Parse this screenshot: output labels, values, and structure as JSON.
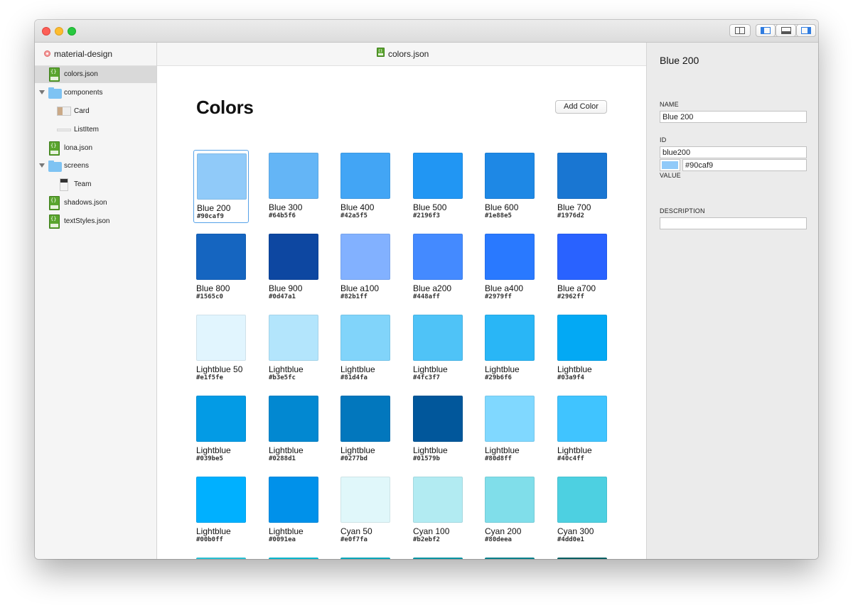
{
  "window": {
    "project_name": "material-design",
    "file_title": "colors.json"
  },
  "sidebar": {
    "items": [
      {
        "label": "colors.json",
        "icon": "json-file-icon",
        "selected": true
      },
      {
        "label": "components",
        "icon": "folder-icon"
      },
      {
        "label": "Card",
        "icon": "component-thumbnail-icon"
      },
      {
        "label": "ListItem",
        "icon": "component-thumbnail-icon"
      },
      {
        "label": "lona.json",
        "icon": "json-file-icon"
      },
      {
        "label": "screens",
        "icon": "folder-icon"
      },
      {
        "label": "Team",
        "icon": "screen-thumbnail-icon"
      },
      {
        "label": "shadows.json",
        "icon": "json-file-icon"
      },
      {
        "label": "textStyles.json",
        "icon": "json-file-icon"
      }
    ]
  },
  "main": {
    "title": "Colors",
    "add_button": "Add Color",
    "colors": [
      {
        "name": "Blue 200",
        "hex": "#90caf9",
        "selected": true
      },
      {
        "name": "Blue 300",
        "hex": "#64b5f6"
      },
      {
        "name": "Blue 400",
        "hex": "#42a5f5"
      },
      {
        "name": "Blue 500",
        "hex": "#2196f3"
      },
      {
        "name": "Blue 600",
        "hex": "#1e88e5"
      },
      {
        "name": "Blue 700",
        "hex": "#1976d2"
      },
      {
        "name": "Blue 800",
        "hex": "#1565c0"
      },
      {
        "name": "Blue 900",
        "hex": "#0d47a1"
      },
      {
        "name": "Blue a100",
        "hex": "#82b1ff"
      },
      {
        "name": "Blue a200",
        "hex": "#448aff"
      },
      {
        "name": "Blue a400",
        "hex": "#2979ff"
      },
      {
        "name": "Blue a700",
        "hex": "#2962ff"
      },
      {
        "name": "Lightblue 50",
        "hex": "#e1f5fe"
      },
      {
        "name": "Lightblue",
        "hex": "#b3e5fc"
      },
      {
        "name": "Lightblue",
        "hex": "#81d4fa"
      },
      {
        "name": "Lightblue",
        "hex": "#4fc3f7"
      },
      {
        "name": "Lightblue",
        "hex": "#29b6f6"
      },
      {
        "name": "Lightblue",
        "hex": "#03a9f4"
      },
      {
        "name": "Lightblue",
        "hex": "#039be5"
      },
      {
        "name": "Lightblue",
        "hex": "#0288d1"
      },
      {
        "name": "Lightblue",
        "hex": "#0277bd"
      },
      {
        "name": "Lightblue",
        "hex": "#01579b"
      },
      {
        "name": "Lightblue",
        "hex": "#80d8ff"
      },
      {
        "name": "Lightblue",
        "hex": "#40c4ff"
      },
      {
        "name": "Lightblue",
        "hex": "#00b0ff"
      },
      {
        "name": "Lightblue",
        "hex": "#0091ea"
      },
      {
        "name": "Cyan 50",
        "hex": "#e0f7fa"
      },
      {
        "name": "Cyan 100",
        "hex": "#b2ebf2"
      },
      {
        "name": "Cyan 200",
        "hex": "#80deea"
      },
      {
        "name": "Cyan 300",
        "hex": "#4dd0e1"
      },
      {
        "name": "",
        "hex": "",
        "swatch": "#26c6da"
      },
      {
        "name": "",
        "hex": "",
        "swatch": "#00bcd4"
      },
      {
        "name": "",
        "hex": "",
        "swatch": "#00acc1"
      },
      {
        "name": "",
        "hex": "",
        "swatch": "#0097a7"
      },
      {
        "name": "",
        "hex": "",
        "swatch": "#00838f"
      },
      {
        "name": "",
        "hex": "",
        "swatch": "#006064"
      }
    ]
  },
  "inspector": {
    "title": "Blue 200",
    "name_label": "NAME",
    "name_value": "Blue 200",
    "id_label": "ID",
    "id_value": "blue200",
    "value_label": "VALUE",
    "value_hex": "#90caf9",
    "description_label": "DESCRIPTION",
    "description_value": ""
  },
  "colors": {
    "selection_border": "#55a1e8",
    "sidebar_background": "#f5f5f5",
    "inspector_background": "#ebebeb",
    "json_icon": "#5aa52e",
    "folder_icon": "#7ec3f3"
  }
}
